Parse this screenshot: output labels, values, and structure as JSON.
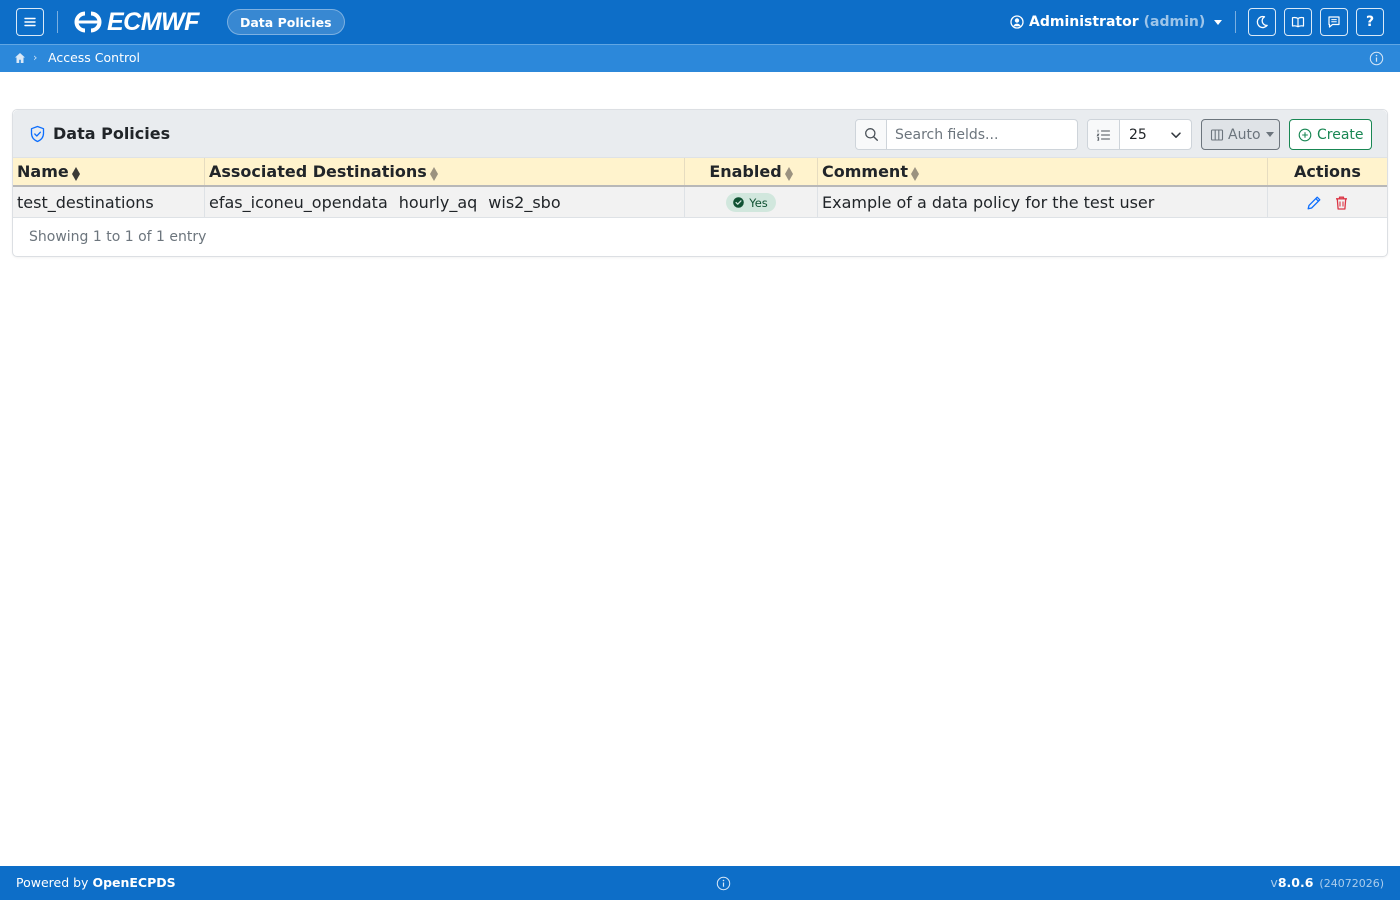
{
  "navbar": {
    "brand": "ECMWF",
    "page_pill": "Data Policies",
    "user_name": "Administrator",
    "user_role": "(admin)",
    "icons": [
      "menu-icon",
      "moon-icon",
      "book-icon",
      "chat-icon",
      "help-icon"
    ],
    "help_label": "?"
  },
  "breadcrumb": {
    "separator": "›",
    "items": [
      "Access Control"
    ]
  },
  "card": {
    "title": "Data Policies",
    "search": {
      "placeholder": "Search fields...",
      "value": ""
    },
    "page_size": "25",
    "columns_button": "Auto",
    "create_button": "Create",
    "showing": "Showing 1 to 1 of 1 entry"
  },
  "table": {
    "headers": [
      "Name",
      "Associated Destinations",
      "Enabled",
      "Comment",
      "Actions"
    ],
    "rows": [
      {
        "name": "test_destinations",
        "destinations": [
          "efas_iconeu_opendata",
          "hourly_aq",
          "wis2_sbo"
        ],
        "enabled": "Yes",
        "comment": "Example of a data policy for the test user"
      }
    ]
  },
  "footer": {
    "powered_prefix": "Powered by ",
    "powered_name": "OpenECPDS",
    "version_prefix": "v",
    "version": "8.0.6",
    "build": "(24072026)"
  },
  "colors": {
    "navbar": "#0d6ec8",
    "breadcrumb_bar": "#2c88da",
    "table_header": "#fff3cd",
    "success": "#198754",
    "danger": "#dc3545",
    "edit": "#0d6efd"
  }
}
